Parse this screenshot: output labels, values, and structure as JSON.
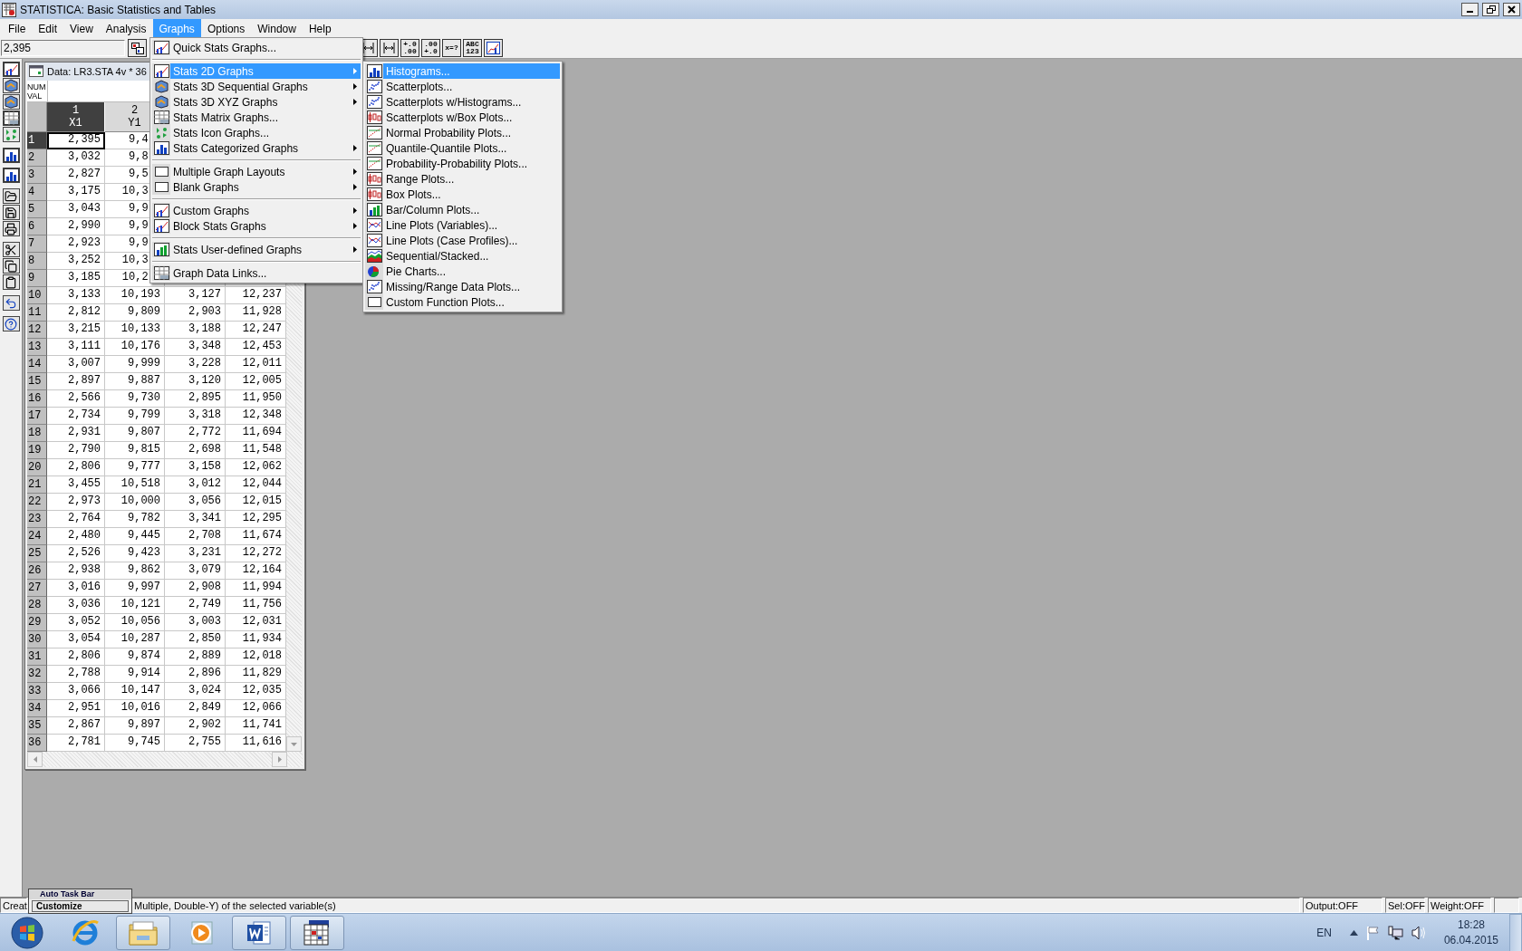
{
  "window": {
    "title": "STATISTICA: Basic Statistics and Tables"
  },
  "menu_bar": [
    {
      "label": "File",
      "selected": false
    },
    {
      "label": "Edit",
      "selected": false
    },
    {
      "label": "View",
      "selected": false
    },
    {
      "label": "Analysis",
      "selected": false
    },
    {
      "label": "Graphs",
      "selected": true
    },
    {
      "label": "Options",
      "selected": false
    },
    {
      "label": "Window",
      "selected": false
    },
    {
      "label": "Help",
      "selected": false
    }
  ],
  "toolbar": {
    "cell_value": "2,395",
    "buttons": [
      {
        "kind": "icon"
      },
      {
        "kind": "icon"
      },
      {
        "kind": "text",
        "lines": [
          "+.0",
          ".00"
        ]
      },
      {
        "kind": "text",
        "lines": [
          ".00",
          "+.0"
        ]
      },
      {
        "kind": "text",
        "lines": [
          "x=?"
        ]
      },
      {
        "kind": "text",
        "lines": [
          "ABC",
          "123"
        ]
      },
      {
        "kind": "icon"
      }
    ]
  },
  "graphs_menu": [
    {
      "kind": "item",
      "label": "Quick Stats Graphs...",
      "submenu": false,
      "selected": false
    },
    {
      "kind": "separator"
    },
    {
      "kind": "item",
      "label": "Stats 2D Graphs",
      "submenu": true,
      "selected": true
    },
    {
      "kind": "item",
      "label": "Stats 3D Sequential Graphs",
      "submenu": true,
      "selected": false
    },
    {
      "kind": "item",
      "label": "Stats 3D XYZ Graphs",
      "submenu": true,
      "selected": false
    },
    {
      "kind": "item",
      "label": "Stats Matrix Graphs...",
      "submenu": false,
      "selected": false
    },
    {
      "kind": "item",
      "label": "Stats Icon Graphs...",
      "submenu": false,
      "selected": false
    },
    {
      "kind": "item",
      "label": "Stats Categorized Graphs",
      "submenu": true,
      "selected": false
    },
    {
      "kind": "separator"
    },
    {
      "kind": "item",
      "label": "Multiple Graph Layouts",
      "submenu": true,
      "selected": false
    },
    {
      "kind": "item",
      "label": "Blank Graphs",
      "submenu": true,
      "selected": false
    },
    {
      "kind": "separator"
    },
    {
      "kind": "item",
      "label": "Custom Graphs",
      "submenu": true,
      "selected": false
    },
    {
      "kind": "item",
      "label": "Block Stats Graphs",
      "submenu": true,
      "selected": false
    },
    {
      "kind": "separator"
    },
    {
      "kind": "item",
      "label": "Stats User-defined Graphs",
      "submenu": true,
      "selected": false
    },
    {
      "kind": "separator"
    },
    {
      "kind": "item",
      "label": "Graph Data Links...",
      "submenu": false,
      "selected": false
    }
  ],
  "stats_2d_submenu": [
    {
      "label": "Histograms...",
      "selected": true
    },
    {
      "label": "Scatterplots...",
      "selected": false
    },
    {
      "label": "Scatterplots w/Histograms...",
      "selected": false
    },
    {
      "label": "Scatterplots w/Box Plots...",
      "selected": false
    },
    {
      "label": "Normal Probability Plots...",
      "selected": false
    },
    {
      "label": "Quantile-Quantile Plots...",
      "selected": false
    },
    {
      "label": "Probability-Probability Plots...",
      "selected": false
    },
    {
      "label": "Range Plots...",
      "selected": false
    },
    {
      "label": "Box Plots...",
      "selected": false
    },
    {
      "label": "Bar/Column Plots...",
      "selected": false
    },
    {
      "label": "Line Plots (Variables)...",
      "selected": false
    },
    {
      "label": "Line Plots (Case Profiles)...",
      "selected": false
    },
    {
      "label": "Sequential/Stacked...",
      "selected": false
    },
    {
      "label": "Pie Charts...",
      "selected": false
    },
    {
      "label": "Missing/Range Data Plots...",
      "selected": false
    },
    {
      "label": "Custom Function Plots...",
      "selected": false
    }
  ],
  "data_window": {
    "title": "Data: LR3.STA 4v * 36",
    "info_lines": [
      "NUM",
      "VAL"
    ],
    "columns": [
      {
        "number": "1",
        "name": "X1",
        "selected": true
      },
      {
        "number": "2",
        "name": "Y1",
        "selected": false
      }
    ],
    "rows": [
      {
        "label": "1",
        "selected": true,
        "cells": [
          "2,395",
          "9,4"
        ]
      },
      {
        "label": "2",
        "selected": false,
        "cells": [
          "3,032",
          "9,8"
        ]
      },
      {
        "label": "3",
        "selected": false,
        "cells": [
          "2,827",
          "9,5"
        ]
      },
      {
        "label": "4",
        "selected": false,
        "cells": [
          "3,175",
          "10,3"
        ]
      },
      {
        "label": "5",
        "selected": false,
        "cells": [
          "3,043",
          "9,9"
        ]
      },
      {
        "label": "6",
        "selected": false,
        "cells": [
          "2,990",
          "9,9"
        ]
      },
      {
        "label": "7",
        "selected": false,
        "cells": [
          "2,923",
          "9,9"
        ]
      },
      {
        "label": "8",
        "selected": false,
        "cells": [
          "3,252",
          "10,3"
        ]
      },
      {
        "label": "9",
        "selected": false,
        "cells": [
          "3,185",
          "10,2"
        ]
      },
      {
        "label": "10",
        "selected": false,
        "cells": [
          "3,133",
          "10,193",
          "3,127",
          "12,237"
        ]
      },
      {
        "label": "11",
        "selected": false,
        "cells": [
          "2,812",
          "9,809",
          "2,903",
          "11,928"
        ]
      },
      {
        "label": "12",
        "selected": false,
        "cells": [
          "3,215",
          "10,133",
          "3,188",
          "12,247"
        ]
      },
      {
        "label": "13",
        "selected": false,
        "cells": [
          "3,111",
          "10,176",
          "3,348",
          "12,453"
        ]
      },
      {
        "label": "14",
        "selected": false,
        "cells": [
          "3,007",
          "9,999",
          "3,228",
          "12,011"
        ]
      },
      {
        "label": "15",
        "selected": false,
        "cells": [
          "2,897",
          "9,887",
          "3,120",
          "12,005"
        ]
      },
      {
        "label": "16",
        "selected": false,
        "cells": [
          "2,566",
          "9,730",
          "2,895",
          "11,950"
        ]
      },
      {
        "label": "17",
        "selected": false,
        "cells": [
          "2,734",
          "9,799",
          "3,318",
          "12,348"
        ]
      },
      {
        "label": "18",
        "selected": false,
        "cells": [
          "2,931",
          "9,807",
          "2,772",
          "11,694"
        ]
      },
      {
        "label": "19",
        "selected": false,
        "cells": [
          "2,790",
          "9,815",
          "2,698",
          "11,548"
        ]
      },
      {
        "label": "20",
        "selected": false,
        "cells": [
          "2,806",
          "9,777",
          "3,158",
          "12,062"
        ]
      },
      {
        "label": "21",
        "selected": false,
        "cells": [
          "3,455",
          "10,518",
          "3,012",
          "12,044"
        ]
      },
      {
        "label": "22",
        "selected": false,
        "cells": [
          "2,973",
          "10,000",
          "3,056",
          "12,015"
        ]
      },
      {
        "label": "23",
        "selected": false,
        "cells": [
          "2,764",
          "9,782",
          "3,341",
          "12,295"
        ]
      },
      {
        "label": "24",
        "selected": false,
        "cells": [
          "2,480",
          "9,445",
          "2,708",
          "11,674"
        ]
      },
      {
        "label": "25",
        "selected": false,
        "cells": [
          "2,526",
          "9,423",
          "3,231",
          "12,272"
        ]
      },
      {
        "label": "26",
        "selected": false,
        "cells": [
          "2,938",
          "9,862",
          "3,079",
          "12,164"
        ]
      },
      {
        "label": "27",
        "selected": false,
        "cells": [
          "3,016",
          "9,997",
          "2,908",
          "11,994"
        ]
      },
      {
        "label": "28",
        "selected": false,
        "cells": [
          "3,036",
          "10,121",
          "2,749",
          "11,756"
        ]
      },
      {
        "label": "29",
        "selected": false,
        "cells": [
          "3,052",
          "10,056",
          "3,003",
          "12,031"
        ]
      },
      {
        "label": "30",
        "selected": false,
        "cells": [
          "3,054",
          "10,287",
          "2,850",
          "11,934"
        ]
      },
      {
        "label": "31",
        "selected": false,
        "cells": [
          "2,806",
          "9,874",
          "2,889",
          "12,018"
        ]
      },
      {
        "label": "32",
        "selected": false,
        "cells": [
          "2,788",
          "9,914",
          "2,896",
          "11,829"
        ]
      },
      {
        "label": "33",
        "selected": false,
        "cells": [
          "3,066",
          "10,147",
          "3,024",
          "12,035"
        ]
      },
      {
        "label": "34",
        "selected": false,
        "cells": [
          "2,951",
          "10,016",
          "2,849",
          "12,066"
        ]
      },
      {
        "label": "35",
        "selected": false,
        "cells": [
          "2,867",
          "9,897",
          "2,902",
          "11,741"
        ]
      },
      {
        "label": "36",
        "selected": false,
        "cells": [
          "2,781",
          "9,745",
          "2,755",
          "11,616"
        ]
      }
    ]
  },
  "auto_task_bar": {
    "title": "Auto Task Bar",
    "button": "Customize"
  },
  "status_bar": {
    "left": "Creat",
    "message": "Multiple, Double-Y) of the selected variable(s)",
    "panels": [
      "Output:OFF",
      "Sel:OFF",
      "Weight:OFF"
    ]
  },
  "taskbar": {
    "apps": [
      {
        "kind": "browser",
        "running": false
      },
      {
        "kind": "folder",
        "running": true
      },
      {
        "kind": "media",
        "running": false
      },
      {
        "kind": "word",
        "running": true
      },
      {
        "kind": "statistica",
        "running": true
      }
    ],
    "language": "EN",
    "time": "18:28",
    "date": "06.04.2015"
  }
}
